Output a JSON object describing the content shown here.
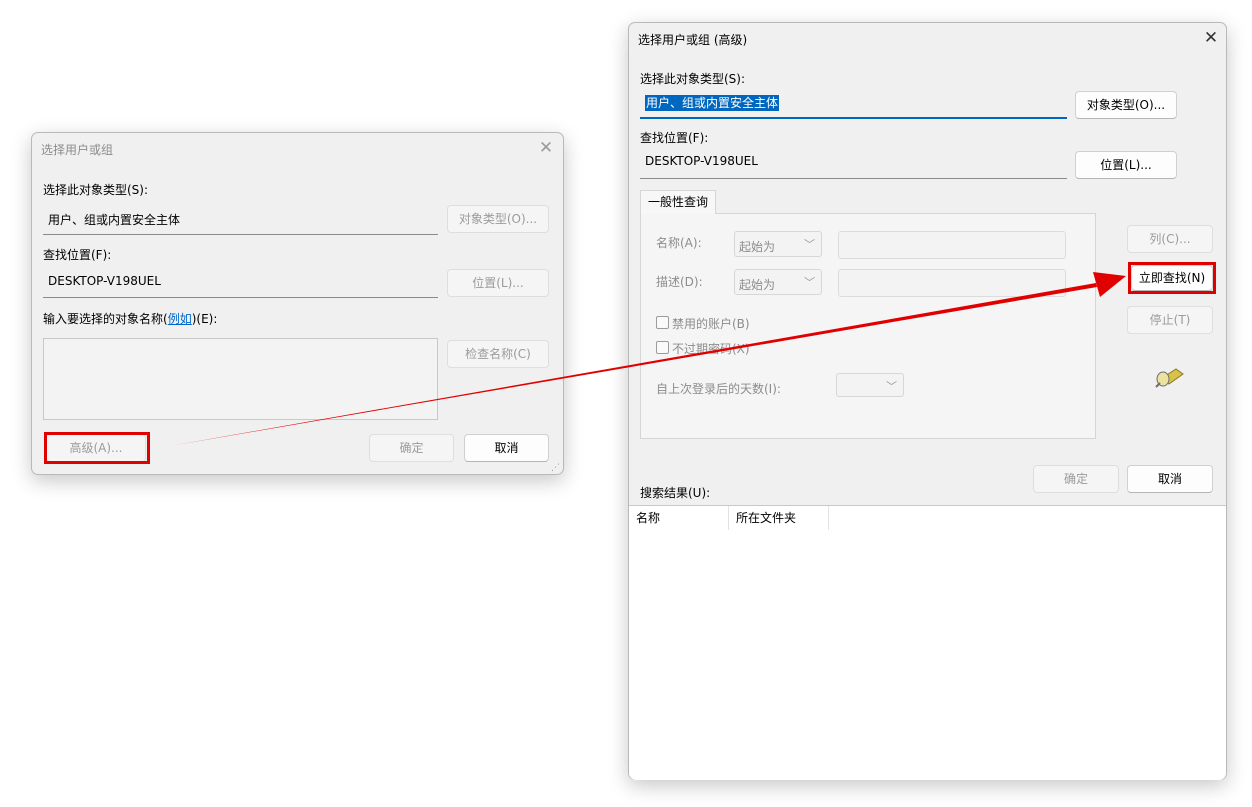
{
  "small_dialog": {
    "title": "选择用户或组",
    "object_type_label": "选择此对象类型(S):",
    "object_type_value": "用户、组或内置安全主体",
    "object_types_button": "对象类型(O)...",
    "location_label": "查找位置(F):",
    "location_value": "DESKTOP-V198UEL",
    "locations_button": "位置(L)...",
    "names_label_prefix": "输入要选择的对象名称(",
    "names_label_link": "例如",
    "names_label_suffix": ")(E):",
    "check_names_button": "检查名称(C)",
    "advanced_button": "高级(A)...",
    "ok_button": "确定",
    "cancel_button": "取消"
  },
  "advanced_dialog": {
    "title": "选择用户或组 (高级)",
    "object_type_label": "选择此对象类型(S):",
    "object_type_value": "用户、组或内置安全主体",
    "object_types_button": "对象类型(O)...",
    "location_label": "查找位置(F):",
    "location_value": "DESKTOP-V198UEL",
    "locations_button": "位置(L)...",
    "tab_label": "一般性查询",
    "name_label": "名称(A):",
    "name_combo": "起始为",
    "description_label": "描述(D):",
    "description_combo": "起始为",
    "disabled_accounts_label": "禁用的账户(B)",
    "non_expiring_label": "不过期密码(X)",
    "days_since_logon_label": "自上次登录后的天数(I):",
    "columns_button": "列(C)...",
    "find_now_button": "立即查找(N)",
    "stop_button": "停止(T)",
    "ok_button": "确定",
    "cancel_button": "取消",
    "search_results_label": "搜索结果(U):",
    "results_columns": [
      "名称",
      "所在文件夹"
    ]
  },
  "colors": {
    "annotation_red": "#e00000",
    "selection_blue": "#0067c0",
    "link_blue": "#0066cc"
  }
}
